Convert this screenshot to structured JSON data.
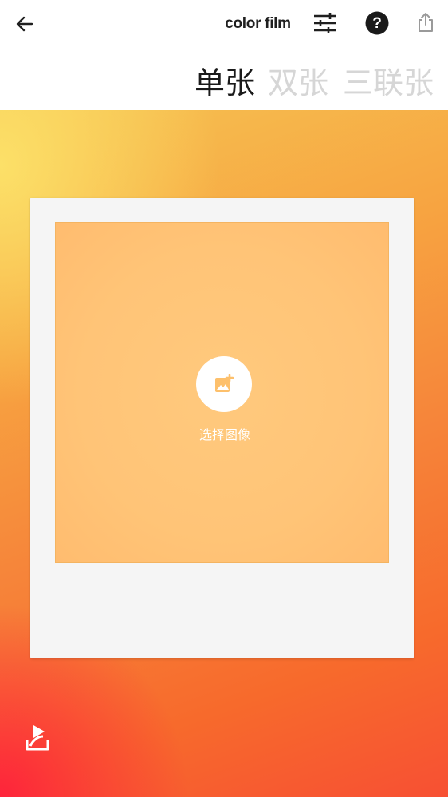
{
  "header": {
    "title": "color film",
    "icons": {
      "back": "arrow-left-icon",
      "settings": "sliders-icon",
      "help": "help-circle-icon",
      "share": "share-upload-icon"
    }
  },
  "tabs": [
    {
      "label": "单张",
      "active": true
    },
    {
      "label": "双张",
      "active": false
    },
    {
      "label": "三联张",
      "active": false
    }
  ],
  "canvas": {
    "select_image_label": "选择图像",
    "add_image_icon": "add-photo-icon",
    "export_icon": "export-share-icon"
  },
  "colors": {
    "gradient_top_left": "#fadb64",
    "gradient_mid": "#f6853a",
    "gradient_bottom_left": "#ff183e",
    "frame": "#f5f5f5",
    "photo_placeholder": "#ffc577",
    "active_tab": "#1a1a1a",
    "inactive_tab": "#d6d6d6"
  }
}
